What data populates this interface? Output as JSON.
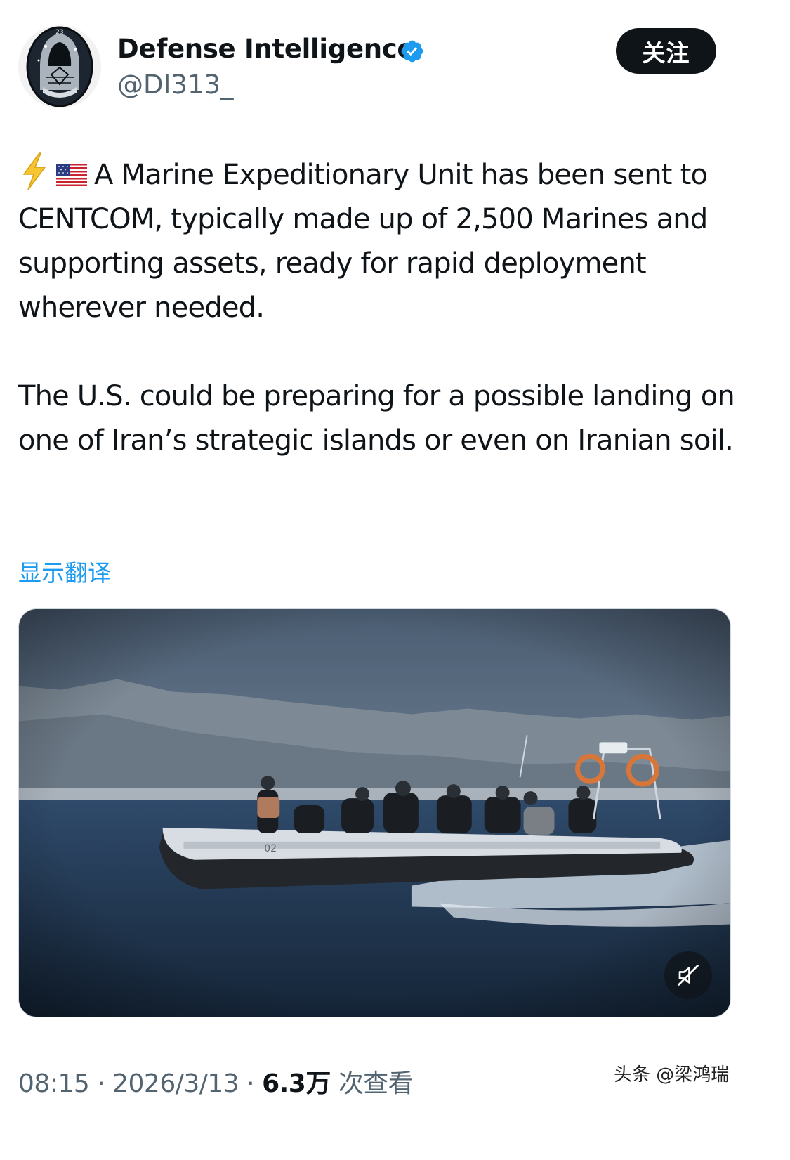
{
  "author": {
    "name": "Defense Intelligence",
    "handle": "@DI313_",
    "avatar_icon": "hooded-figure-patch-icon",
    "verified_icon": "verified-badge-icon",
    "verified_color": "#1d9bf0"
  },
  "follow_button": {
    "label": "关注"
  },
  "tweet": {
    "icons": [
      "lightning-bolt-icon",
      "us-flag-icon"
    ],
    "paragraph1": "A Marine Expeditionary Unit has been sent to CENTCOM, typically made up of 2,500 Marines and supporting assets, ready for rapid deployment wherever needed.",
    "paragraph2": " The U.S. could be preparing for a possible landing on one of Iran’s strategic islands or even on Iranian soil."
  },
  "translate": {
    "label": "显示翻译",
    "color": "#1d9bf0"
  },
  "media": {
    "type": "video",
    "boat_hull_number": "02",
    "mute_icon": "muted-speaker-icon"
  },
  "meta": {
    "time": "08:15",
    "separator": "·",
    "date": "2026/3/13",
    "views_count": "6.3万",
    "views_label": "次查看"
  },
  "watermark": {
    "text": "头条 @梁鸿瑞"
  }
}
